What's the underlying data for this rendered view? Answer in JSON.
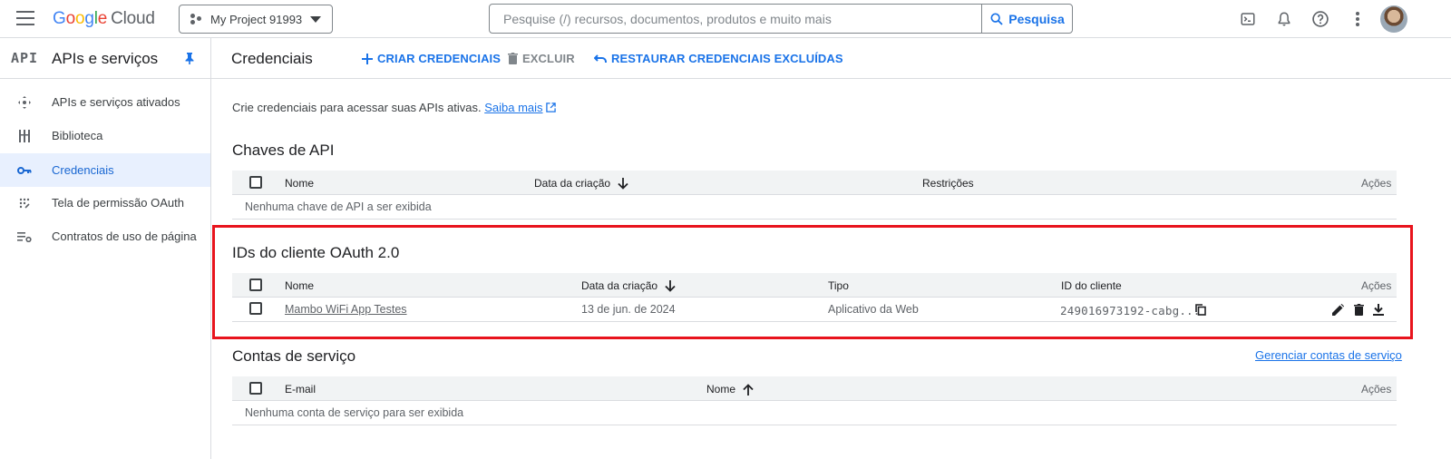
{
  "topbar": {
    "logo_letters": [
      "G",
      "o",
      "o",
      "g",
      "l",
      "e"
    ],
    "logo_cloud": "Cloud",
    "project_name": "My Project 91993",
    "search_placeholder": "Pesquise (/) recursos, documentos, produtos e muito mais",
    "search_button": "Pesquisa",
    "icons": [
      "cloud-shell-icon",
      "notifications-icon",
      "help-icon",
      "more-vert-icon",
      "account-avatar"
    ]
  },
  "sidebar": {
    "badge": "API",
    "title": "APIs e serviços",
    "items": [
      {
        "label": "APIs e serviços ativados",
        "icon": "apis-icon",
        "active": false
      },
      {
        "label": "Biblioteca",
        "icon": "library-icon",
        "active": false
      },
      {
        "label": "Credenciais",
        "icon": "key-icon",
        "active": true
      },
      {
        "label": "Tela de permissão OAuth",
        "icon": "consent-icon",
        "active": false
      },
      {
        "label": "Contratos de uso de página",
        "icon": "agreements-icon",
        "active": false
      }
    ]
  },
  "header": {
    "title": "Credenciais",
    "create": "CRIAR CREDENCIAIS",
    "delete": "EXCLUIR",
    "restore": "RESTAURAR CREDENCIAIS EXCLUÍDAS"
  },
  "intro": {
    "text": "Crie credenciais para acessar suas APIs ativas.",
    "link": "Saiba mais"
  },
  "api_keys": {
    "title": "Chaves de API",
    "columns": {
      "name": "Nome",
      "created": "Data da criação",
      "restrictions": "Restrições",
      "actions": "Ações"
    },
    "empty": "Nenhuma chave de API a ser exibida"
  },
  "oauth": {
    "title": "IDs do cliente OAuth 2.0",
    "columns": {
      "name": "Nome",
      "created": "Data da criação",
      "type": "Tipo",
      "client_id": "ID do cliente",
      "actions": "Ações"
    },
    "rows": [
      {
        "name": "Mambo WiFi App Testes",
        "created": "13 de jun. de 2024",
        "type": "Aplicativo da Web",
        "client_id": "249016973192-cabg..."
      }
    ]
  },
  "service_accounts": {
    "title": "Contas de serviço",
    "manage_link": "Gerenciar contas de serviço",
    "columns": {
      "email": "E-mail",
      "name": "Nome",
      "actions": "Ações"
    },
    "empty": "Nenhuma conta de serviço para ser exibida"
  },
  "colors": {
    "accent": "#1a73e8",
    "highlight_box": "#e8141d",
    "active_nav_bg": "#e8f0fe"
  }
}
